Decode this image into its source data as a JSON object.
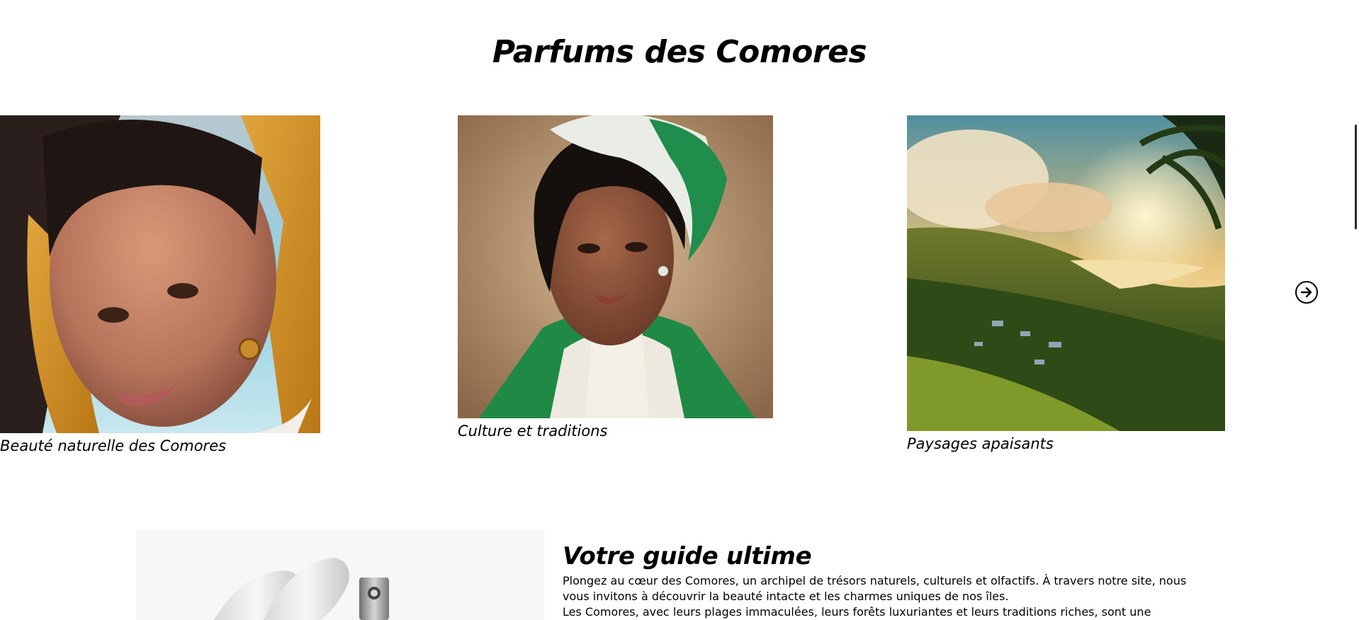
{
  "section": {
    "title": "Parfums des Comores"
  },
  "gallery": {
    "cards": [
      {
        "caption": "Beauté naturelle des Comores"
      },
      {
        "caption": "Culture et traditions"
      },
      {
        "caption": "Paysages apaisants"
      }
    ],
    "next_icon": "arrow-right-circle-icon"
  },
  "guide": {
    "title": "Votre guide ultime",
    "paragraphs": [
      "Plongez au cœur des Comores, un archipel de trésors naturels, culturels et olfactifs. À travers notre site, nous vous invitons à découvrir la beauté intacte et les charmes uniques de nos îles.",
      "Les Comores, avec leurs plages immaculées, leurs forêts luxuriantes et leurs traditions riches, sont une destination"
    ]
  },
  "colors": {
    "background": "#ffffff",
    "text": "#000000"
  }
}
